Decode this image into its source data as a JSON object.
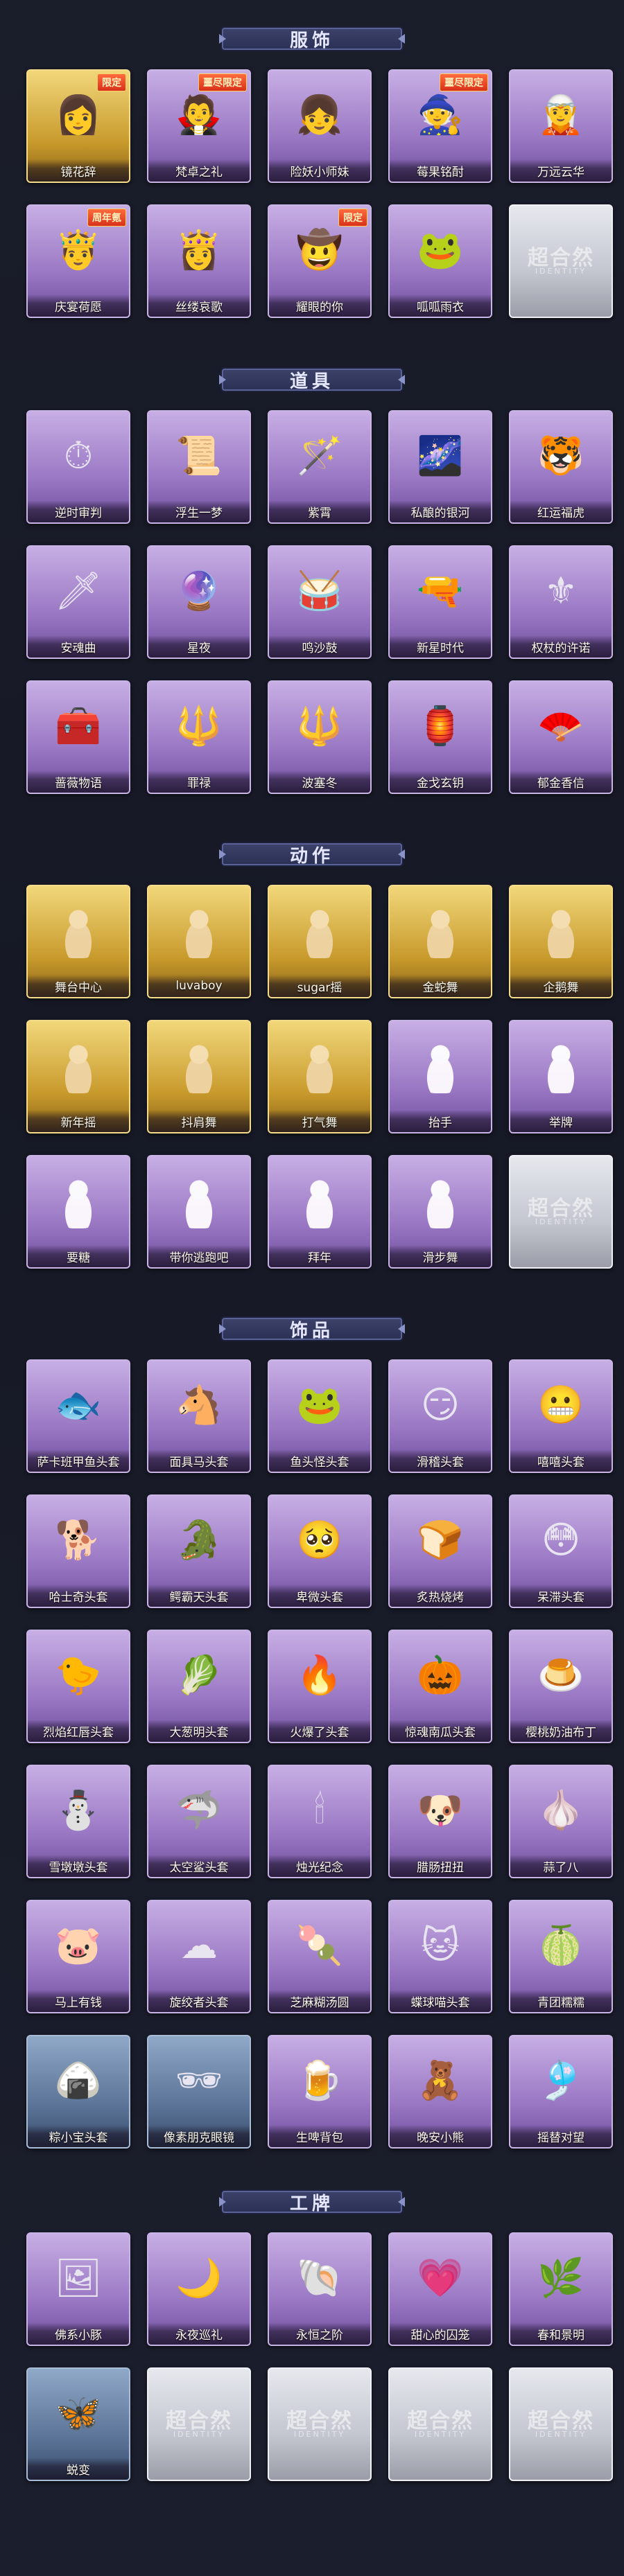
{
  "sections": [
    {
      "title": "服饰",
      "items": [
        {
          "label": "镜花辞",
          "rarity": "gold",
          "icon": "red-hood-character",
          "glyph": "👩",
          "tag": "限定"
        },
        {
          "label": "梵卓之礼",
          "rarity": "purple",
          "icon": "vampire-character",
          "glyph": "🧛",
          "tag": "噩尽限定"
        },
        {
          "label": "险妖小师妹",
          "rarity": "purple",
          "icon": "girl-character",
          "glyph": "👧",
          "tag": ""
        },
        {
          "label": "莓果铭酎",
          "rarity": "purple",
          "icon": "witch-character",
          "glyph": "🧙",
          "tag": "噩尽限定"
        },
        {
          "label": "万远云华",
          "rarity": "purple",
          "icon": "white-hair-character",
          "glyph": "🧝",
          "tag": ""
        },
        {
          "label": "庆宴荷愿",
          "rarity": "purple",
          "icon": "feast-character",
          "glyph": "🤴",
          "tag": "周年氪"
        },
        {
          "label": "丝缕哀歌",
          "rarity": "purple",
          "icon": "dark-girl-character",
          "glyph": "👸",
          "tag": ""
        },
        {
          "label": "耀眼的你",
          "rarity": "purple",
          "icon": "cowgirl-character",
          "glyph": "🤠",
          "tag": "限定"
        },
        {
          "label": "呱呱雨衣",
          "rarity": "purple",
          "icon": "frog-raincoat-character",
          "glyph": "🐸",
          "tag": ""
        },
        {
          "label": "",
          "rarity": "silver",
          "icon": "empty-slot",
          "glyph": "",
          "tag": "",
          "empty": true
        }
      ]
    },
    {
      "title": "道具",
      "items": [
        {
          "label": "逆时审判",
          "rarity": "purple",
          "icon": "pocket-watch-icon",
          "glyph": "⏱",
          "tag": ""
        },
        {
          "label": "浮生一梦",
          "rarity": "purple",
          "icon": "scroll-icon",
          "glyph": "📜",
          "tag": ""
        },
        {
          "label": "紫霄",
          "rarity": "purple",
          "icon": "staff-icon",
          "glyph": "🪄",
          "tag": ""
        },
        {
          "label": "私酿的银河",
          "rarity": "purple",
          "icon": "galaxy-dish-icon",
          "glyph": "🌌",
          "tag": ""
        },
        {
          "label": "红运福虎",
          "rarity": "purple",
          "icon": "tiger-icon",
          "glyph": "🐯",
          "tag": ""
        },
        {
          "label": "安魂曲",
          "rarity": "purple",
          "icon": "blade-icon",
          "glyph": "🗡",
          "tag": ""
        },
        {
          "label": "星夜",
          "rarity": "purple",
          "icon": "starry-baton-icon",
          "glyph": "🔮",
          "tag": ""
        },
        {
          "label": "鸣沙鼓",
          "rarity": "purple",
          "icon": "drum-icon",
          "glyph": "🥁",
          "tag": ""
        },
        {
          "label": "新星时代",
          "rarity": "purple",
          "icon": "revolver-icon",
          "glyph": "🔫",
          "tag": ""
        },
        {
          "label": "权杖的许诺",
          "rarity": "purple",
          "icon": "scepter-icon",
          "glyph": "⚜",
          "tag": ""
        },
        {
          "label": "蔷薇物语",
          "rarity": "purple",
          "icon": "medkit-icon",
          "glyph": "🧰",
          "tag": ""
        },
        {
          "label": "罪禄",
          "rarity": "purple",
          "icon": "spear-icon",
          "glyph": "🔱",
          "tag": ""
        },
        {
          "label": "波塞冬",
          "rarity": "purple",
          "icon": "trident-icon",
          "glyph": "🔱",
          "tag": ""
        },
        {
          "label": "金戈玄钥",
          "rarity": "purple",
          "icon": "lantern-icon",
          "glyph": "🏮",
          "tag": ""
        },
        {
          "label": "郁金香信",
          "rarity": "purple",
          "icon": "fan-icon",
          "glyph": "🪭",
          "tag": ""
        }
      ]
    },
    {
      "title": "动作",
      "items": [
        {
          "label": "舞台中心",
          "rarity": "gold",
          "icon": "pose-icon",
          "pose": true
        },
        {
          "label": "luvaboy",
          "rarity": "gold",
          "icon": "pose-icon",
          "pose": true
        },
        {
          "label": "sugar摇",
          "rarity": "gold",
          "icon": "pose-icon",
          "pose": true
        },
        {
          "label": "金蛇舞",
          "rarity": "gold",
          "icon": "pose-icon",
          "pose": true
        },
        {
          "label": "企鹅舞",
          "rarity": "gold",
          "icon": "pose-icon",
          "pose": true
        },
        {
          "label": "新年摇",
          "rarity": "gold",
          "icon": "pose-icon",
          "pose": true
        },
        {
          "label": "抖肩舞",
          "rarity": "gold",
          "icon": "pose-icon",
          "pose": true
        },
        {
          "label": "打气舞",
          "rarity": "gold",
          "icon": "pose-icon",
          "pose": true
        },
        {
          "label": "抬手",
          "rarity": "purple",
          "icon": "pose-icon",
          "pose": true
        },
        {
          "label": "举牌",
          "rarity": "purple",
          "icon": "pose-icon",
          "pose": true
        },
        {
          "label": "要糖",
          "rarity": "purple",
          "icon": "pose-icon",
          "pose": true
        },
        {
          "label": "带你逃跑吧",
          "rarity": "purple",
          "icon": "pose-icon",
          "pose": true
        },
        {
          "label": "拜年",
          "rarity": "purple",
          "icon": "pose-icon",
          "pose": true
        },
        {
          "label": "滑步舞",
          "rarity": "purple",
          "icon": "pose-icon",
          "pose": true
        },
        {
          "label": "",
          "rarity": "silver",
          "icon": "empty-slot",
          "empty": true
        }
      ]
    },
    {
      "title": "饰品",
      "items": [
        {
          "label": "萨卡班甲鱼头套",
          "rarity": "purple",
          "icon": "fish-head-icon",
          "glyph": "🐟"
        },
        {
          "label": "面具马头套",
          "rarity": "purple",
          "icon": "horse-head-icon",
          "glyph": "🐴"
        },
        {
          "label": "鱼头怪头套",
          "rarity": "purple",
          "icon": "fish-monster-icon",
          "glyph": "🐸"
        },
        {
          "label": "滑稽头套",
          "rarity": "purple",
          "icon": "funny-face-icon",
          "glyph": "😏"
        },
        {
          "label": "嘻嘻头套",
          "rarity": "purple",
          "icon": "grin-face-icon",
          "glyph": "😬"
        },
        {
          "label": "哈士奇头套",
          "rarity": "purple",
          "icon": "husky-icon",
          "glyph": "🐕"
        },
        {
          "label": "鳄霸天头套",
          "rarity": "purple",
          "icon": "crocodile-icon",
          "glyph": "🐊"
        },
        {
          "label": "卑微头套",
          "rarity": "purple",
          "icon": "sad-face-icon",
          "glyph": "🥺"
        },
        {
          "label": "炙热烧烤",
          "rarity": "purple",
          "icon": "toast-icon",
          "glyph": "🍞"
        },
        {
          "label": "呆滞头套",
          "rarity": "purple",
          "icon": "dazed-face-icon",
          "glyph": "😳"
        },
        {
          "label": "烈焰红唇头套",
          "rarity": "purple",
          "icon": "pikachu-icon",
          "glyph": "🐤"
        },
        {
          "label": "大葱明头套",
          "rarity": "purple",
          "icon": "scallion-icon",
          "glyph": "🥬"
        },
        {
          "label": "火爆了头套",
          "rarity": "purple",
          "icon": "fire-icon",
          "glyph": "🔥"
        },
        {
          "label": "惊魂南瓜头套",
          "rarity": "purple",
          "icon": "pumpkin-icon",
          "glyph": "🎃"
        },
        {
          "label": "樱桃奶油布丁",
          "rarity": "purple",
          "icon": "pudding-icon",
          "glyph": "🍮"
        },
        {
          "label": "雪墩墩头套",
          "rarity": "purple",
          "icon": "snowman-icon",
          "glyph": "⛄"
        },
        {
          "label": "太空鲨头套",
          "rarity": "purple",
          "icon": "shark-icon",
          "glyph": "🦈"
        },
        {
          "label": "烛光纪念",
          "rarity": "purple",
          "icon": "candle-icon",
          "glyph": "🕯"
        },
        {
          "label": "腊肠扭扭",
          "rarity": "purple",
          "icon": "dachshund-icon",
          "glyph": "🐶"
        },
        {
          "label": "蒜了八",
          "rarity": "purple",
          "icon": "garlic-icon",
          "glyph": "🧄"
        },
        {
          "label": "马上有钱",
          "rarity": "purple",
          "icon": "pig-icon",
          "glyph": "🐷"
        },
        {
          "label": "旋绞者头套",
          "rarity": "purple",
          "icon": "cloud-face-icon",
          "glyph": "☁"
        },
        {
          "label": "芝麻糊汤圆",
          "rarity": "purple",
          "icon": "tangyuan-icon",
          "glyph": "🍡"
        },
        {
          "label": "蝶球喵头套",
          "rarity": "purple",
          "icon": "cat-icon",
          "glyph": "🐱"
        },
        {
          "label": "青团糯糯",
          "rarity": "purple",
          "icon": "green-dumpling-icon",
          "glyph": "🍈"
        },
        {
          "label": "粽小宝头套",
          "rarity": "blue",
          "icon": "zongzi-icon",
          "glyph": "🍙"
        },
        {
          "label": "像素朋克眼镜",
          "rarity": "blue",
          "icon": "pixel-glasses-icon",
          "glyph": "🕶"
        },
        {
          "label": "生啤背包",
          "rarity": "purple",
          "icon": "beer-backpack-icon",
          "glyph": "🍺"
        },
        {
          "label": "晚安小熊",
          "rarity": "purple",
          "icon": "bear-icon",
          "glyph": "🧸"
        },
        {
          "label": "摇替对望",
          "rarity": "purple",
          "icon": "pendant-icon",
          "glyph": "🎐"
        }
      ]
    },
    {
      "title": "工牌",
      "items": [
        {
          "label": "佛系小豚",
          "rarity": "purple",
          "icon": "badge-icon",
          "glyph": "🖼"
        },
        {
          "label": "永夜巡礼",
          "rarity": "purple",
          "icon": "night-badge-icon",
          "glyph": "🌙"
        },
        {
          "label": "永恒之阶",
          "rarity": "purple",
          "icon": "shell-badge-icon",
          "glyph": "🐚"
        },
        {
          "label": "甜心的囚笼",
          "rarity": "purple",
          "icon": "pink-badge-icon",
          "glyph": "💗"
        },
        {
          "label": "春和景明",
          "rarity": "purple",
          "icon": "spring-badge-icon",
          "glyph": "🌿"
        },
        {
          "label": "蜕变",
          "rarity": "blue",
          "icon": "metamorphosis-badge-icon",
          "glyph": "🦋"
        },
        {
          "label": "",
          "rarity": "silver",
          "icon": "empty-slot",
          "empty": true
        },
        {
          "label": "",
          "rarity": "silver",
          "icon": "empty-slot",
          "empty": true
        },
        {
          "label": "",
          "rarity": "silver",
          "icon": "empty-slot",
          "empty": true
        },
        {
          "label": "",
          "rarity": "silver",
          "icon": "empty-slot",
          "empty": true
        }
      ]
    }
  ],
  "empty_watermark": "超合然",
  "empty_watermark_sub": "IDENTITY"
}
